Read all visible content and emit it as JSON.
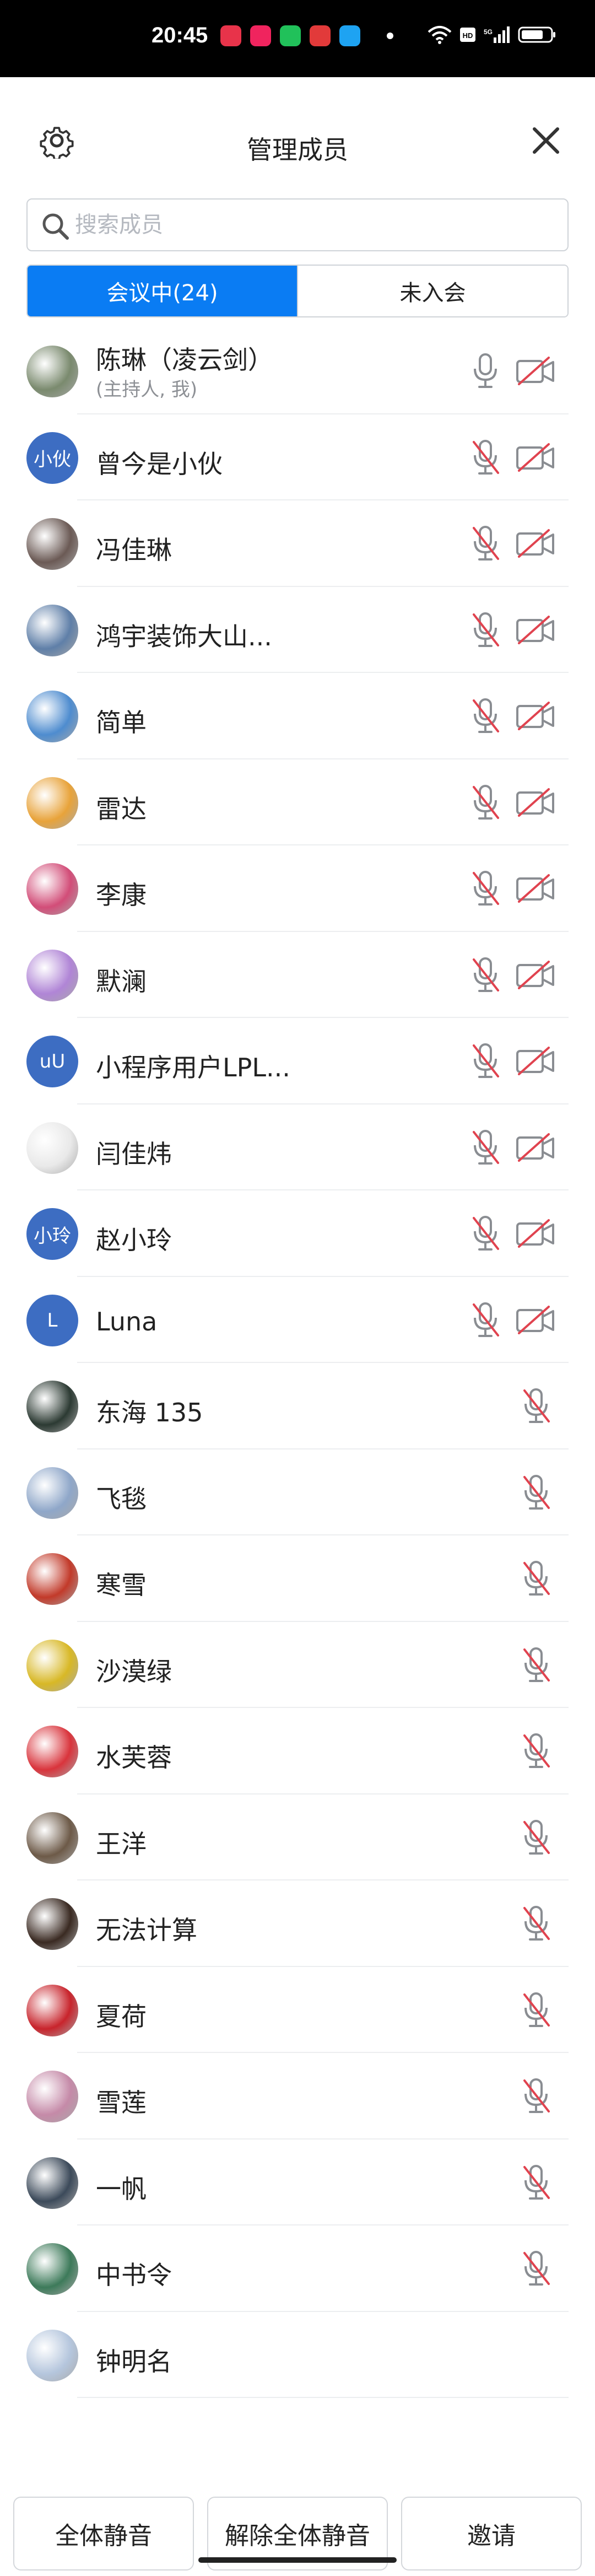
{
  "status_bar": {
    "time": "20:45",
    "apps": [
      {
        "icon": "app-icon-red",
        "color": "#e8334a"
      },
      {
        "icon": "app-icon-video",
        "color": "#f0245e"
      },
      {
        "icon": "app-icon-green",
        "color": "#21c15a"
      },
      {
        "icon": "app-icon-hdr",
        "color": "#e23a3a"
      },
      {
        "icon": "app-icon-qq",
        "color": "#1ea3f2"
      }
    ],
    "system_icons": [
      "wifi-icon",
      "hd-icon",
      "signal-icon",
      "battery-icon"
    ]
  },
  "header": {
    "title": "管理成员",
    "settings_icon": "gear-icon",
    "close_icon": "close-icon"
  },
  "search": {
    "placeholder": "搜索成员",
    "value": ""
  },
  "tabs": [
    {
      "label": "会议中(24)",
      "active": true
    },
    {
      "label": "未入会",
      "active": false
    }
  ],
  "members": [
    {
      "name": "陈琳（凌云剑）",
      "sub": "(主持人, 我)",
      "avatar": "photo",
      "color": "#7a8a6e",
      "mic": "on",
      "cam": "off"
    },
    {
      "name": "曾今是小伙",
      "avatar_text": "小伙",
      "mic": "muted",
      "cam": "off"
    },
    {
      "name": "冯佳琳",
      "avatar": "photo",
      "color": "#6b5a55",
      "mic": "muted",
      "cam": "off"
    },
    {
      "name": "鸿宇装饰大山...",
      "avatar": "photo",
      "color": "#5f7fa8",
      "mic": "muted",
      "cam": "off"
    },
    {
      "name": "简单",
      "avatar": "photo",
      "color": "#4e8ccf",
      "mic": "muted",
      "cam": "off"
    },
    {
      "name": "雷达",
      "avatar": "photo",
      "color": "#e8a33a",
      "mic": "muted",
      "cam": "off"
    },
    {
      "name": "李康",
      "avatar": "photo",
      "color": "#d24d78",
      "mic": "muted",
      "cam": "off"
    },
    {
      "name": "默澜",
      "avatar": "photo",
      "color": "#b085d6",
      "mic": "muted",
      "cam": "off"
    },
    {
      "name": "小程序用户LPL...",
      "avatar_text": "uU",
      "mic": "muted",
      "cam": "off"
    },
    {
      "name": "闫佳炜",
      "avatar": "photo",
      "color": "#e9e9e9",
      "mic": "muted",
      "cam": "off"
    },
    {
      "name": "赵小玲",
      "avatar_text": "小玲",
      "mic": "muted",
      "cam": "off"
    },
    {
      "name": "Luna",
      "avatar_text": "L",
      "mic": "muted",
      "cam": "off"
    },
    {
      "name": "东海 135",
      "avatar": "photo",
      "color": "#2c3a33",
      "mic": "muted",
      "cam": "none"
    },
    {
      "name": "飞毯",
      "avatar": "photo",
      "color": "#8fa7c9",
      "mic": "muted",
      "cam": "none"
    },
    {
      "name": "寒雪",
      "avatar": "photo",
      "color": "#c23a2a",
      "mic": "muted",
      "cam": "none"
    },
    {
      "name": "沙漠绿",
      "avatar": "photo",
      "color": "#d8b826",
      "mic": "muted",
      "cam": "none"
    },
    {
      "name": "水芙蓉",
      "avatar": "photo",
      "color": "#d9343c",
      "mic": "muted",
      "cam": "none"
    },
    {
      "name": "王洋",
      "avatar": "photo",
      "color": "#6d5a48",
      "mic": "muted",
      "cam": "none"
    },
    {
      "name": "无法计算",
      "avatar": "photo",
      "color": "#3a2a22",
      "mic": "muted",
      "cam": "none"
    },
    {
      "name": "夏荷",
      "avatar": "photo",
      "color": "#c8242c",
      "mic": "muted",
      "cam": "none"
    },
    {
      "name": "雪莲",
      "avatar": "photo",
      "color": "#c58aa8",
      "mic": "muted",
      "cam": "none"
    },
    {
      "name": "一帆",
      "avatar": "photo",
      "color": "#3c4a5a",
      "mic": "muted",
      "cam": "none"
    },
    {
      "name": "中书令",
      "avatar": "photo",
      "color": "#3d7a5a",
      "mic": "muted",
      "cam": "none"
    },
    {
      "name": "钟明名",
      "avatar": "photo",
      "color": "#b5c6dd",
      "mic": "none",
      "cam": "none"
    }
  ],
  "bottom_buttons": {
    "mute_all": "全体静音",
    "unmute_all": "解除全体静音",
    "invite": "邀请"
  },
  "colors": {
    "accent": "#0a7cf3",
    "muted_red": "#e0434f",
    "icon_gray": "#8a8d92"
  }
}
